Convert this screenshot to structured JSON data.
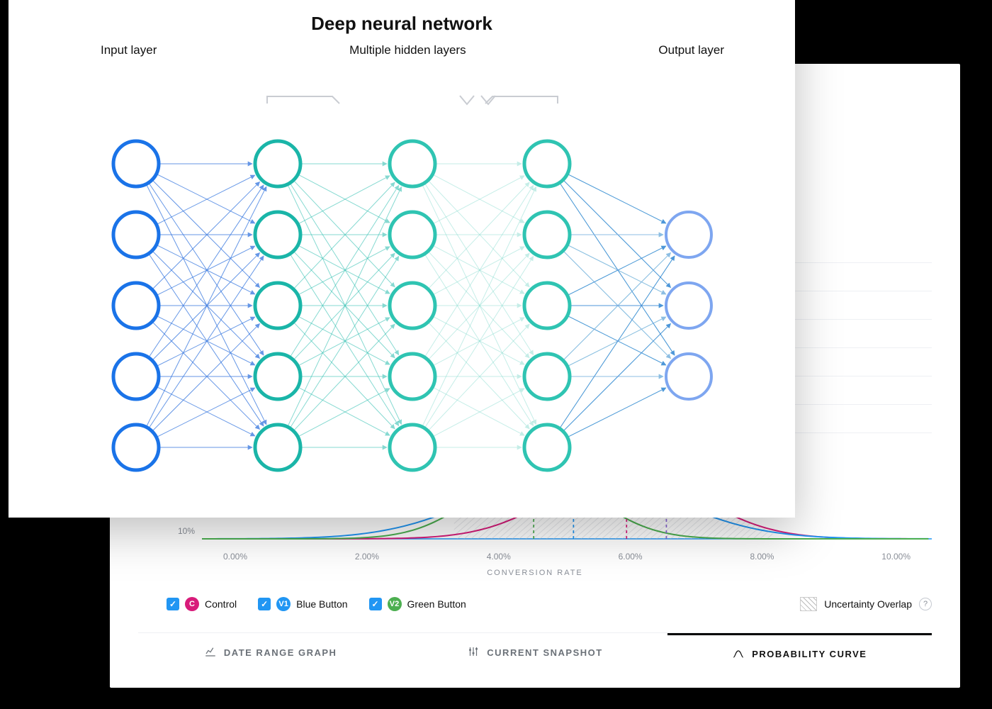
{
  "diagram": {
    "title": "Deep neural network",
    "labels": {
      "input": "Input layer",
      "hidden": "Multiple hidden layers",
      "output": "Output layer"
    },
    "layers": [
      {
        "name": "input",
        "nodes": 5,
        "color": "#1a73e8"
      },
      {
        "name": "hidden1",
        "nodes": 5,
        "color": "#1ab5a8"
      },
      {
        "name": "hidden2",
        "nodes": 5,
        "color": "#2fc4b2"
      },
      {
        "name": "hidden3",
        "nodes": 5,
        "color": "#2fc4b2"
      },
      {
        "name": "output",
        "nodes": 3,
        "color": "#7ea6f0"
      }
    ]
  },
  "analytics": {
    "ylabel": "10%",
    "xticks": [
      "0.00%",
      "2.00%",
      "4.00%",
      "6.00%",
      "8.00%",
      "10.00%"
    ],
    "xlabel": "CONVERSION RATE",
    "legend": {
      "control": "Control",
      "v1": "Blue Button",
      "v2": "Green Button",
      "overlap": "Uncertainty Overlap"
    },
    "badges": {
      "control": "C",
      "v1": "V1",
      "v2": "V2"
    },
    "tabs": {
      "date_range": "DATE RANGE GRAPH",
      "snapshot": "CURRENT SNAPSHOT",
      "prob": "PROBABILITY CURVE"
    },
    "active_tab": "prob",
    "curves": [
      {
        "name": "Control",
        "color": "#d81b7a",
        "mean": 6.4,
        "sd": 1.1
      },
      {
        "name": "Blue Button",
        "color": "#2196f3",
        "mean": 5.6,
        "sd": 1.4
      },
      {
        "name": "Green Button",
        "color": "#4caf50",
        "mean": 5.0,
        "sd": 0.9
      }
    ],
    "dashed_lines": [
      {
        "x": 5.0,
        "color": "#4caf50"
      },
      {
        "x": 5.6,
        "color": "#2196f3"
      },
      {
        "x": 6.4,
        "color": "#d81b7a"
      },
      {
        "x": 7.0,
        "color": "#8a66d6"
      }
    ]
  }
}
